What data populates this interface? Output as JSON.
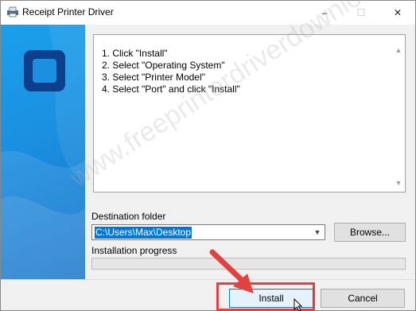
{
  "window": {
    "title": "Receipt Printer Driver",
    "min_label": "–",
    "max_label": "☐",
    "close_label": "✕"
  },
  "instructions": {
    "lines": [
      "1. Click \"Install\"",
      "2. Select \"Operating System\"",
      "3. Select \"Printer Model\"",
      "4. Select \"Port\" and click \"Install\""
    ]
  },
  "destination": {
    "label": "Destination folder",
    "value": "C:\\Users\\Max\\Desktop",
    "browse_label": "Browse..."
  },
  "progress": {
    "label": "Installation progress",
    "value": 0
  },
  "buttons": {
    "install_label": "Install",
    "cancel_label": "Cancel"
  },
  "watermark": "www.freeprinterdriverdownload.org",
  "colors": {
    "accent": "#0078d7",
    "highlight": "#e34040",
    "banner": "#1b8fe0"
  }
}
